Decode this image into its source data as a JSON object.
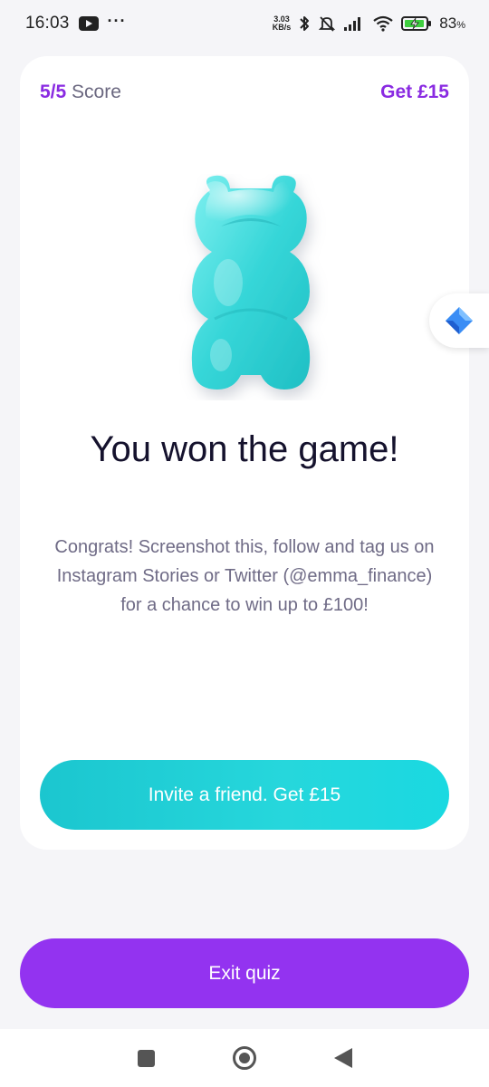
{
  "status_bar": {
    "time": "16:03",
    "net_speed_value": "3.03",
    "net_speed_unit": "KB/s",
    "battery_percent": "83",
    "battery_symbol": "%",
    "icons": [
      "youtube-icon",
      "more-dots-icon",
      "bluetooth-icon",
      "mute-icon",
      "signal-icon",
      "wifi-icon",
      "battery-charging-icon"
    ]
  },
  "card": {
    "score_value": "5/5",
    "score_label": "Score",
    "get_reward": "Get £15",
    "title": "You won the game!",
    "description": "Congrats! Screenshot this, follow and tag us on Instagram Stories or Twitter (@emma_finance) for a chance to win up to £100!",
    "invite_button": "Invite a friend. Get £15"
  },
  "exit_button": "Exit quiz",
  "colors": {
    "accent_purple": "#9333f0",
    "accent_teal": "#1fd0d8",
    "background": "#f5f5f8"
  }
}
